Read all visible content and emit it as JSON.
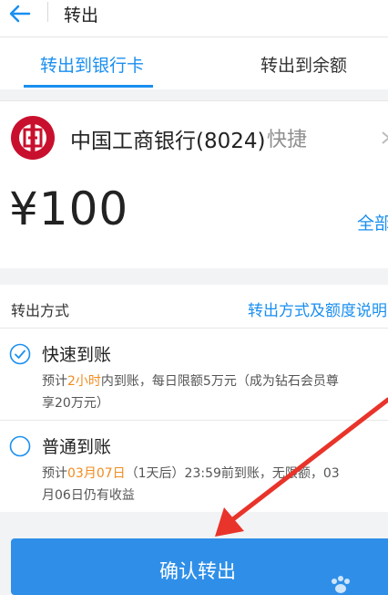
{
  "header": {
    "title": "转出",
    "back_icon": "arrow-left-icon"
  },
  "tabs": [
    {
      "label": "转出到银行卡",
      "active": true
    },
    {
      "label": "转出到余额",
      "active": false
    }
  ],
  "bank": {
    "name": "中国工商银行(8024)",
    "tag": "快捷",
    "logo_icon": "icbc-logo-icon",
    "logo_color": "#c8102e"
  },
  "amount": {
    "display": "¥100",
    "all_link": "全部"
  },
  "method": {
    "label": "转出方式",
    "link": "转出方式及额度说明"
  },
  "options": [
    {
      "title": "快速到账",
      "selected": true,
      "desc": {
        "line1_pre": "预计",
        "line1_hl": "2小时",
        "line1_post": "内到账，每日限额5万元（成为钻石会员尊",
        "line2": "享20万元）"
      }
    },
    {
      "title": "普通到账",
      "selected": false,
      "desc": {
        "line1_pre": "预计",
        "line1_hl": "03月07日",
        "line1_post": "（1天后）23:59前到账，无限额，03",
        "line2": "月06日仍有收益"
      }
    }
  ],
  "confirm": {
    "label": "确认转出"
  },
  "colors": {
    "accent": "#1a8ff0",
    "highlight": "#f08c1e",
    "button": "#2f8fe8",
    "annotation_arrow": "#e8342a"
  }
}
